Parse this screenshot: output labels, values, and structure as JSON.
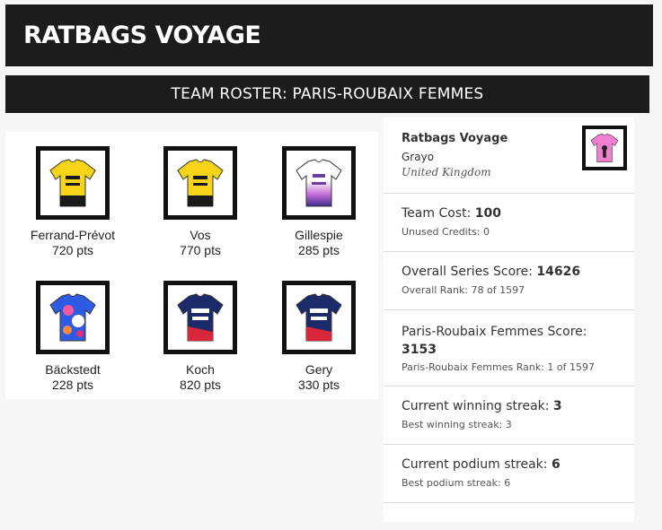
{
  "page": {
    "title": "RATBAGS VOYAGE",
    "subtitle": "TEAM ROSTER: PARIS-ROUBAIX FEMMES"
  },
  "riders": [
    {
      "name": "Ferrand-Prévot",
      "pts": "720 pts",
      "jersey": "visma-jersey-icon"
    },
    {
      "name": "Vos",
      "pts": "770 pts",
      "jersey": "visma-jersey-icon"
    },
    {
      "name": "Gillespie",
      "pts": "285 pts",
      "jersey": "uae-jersey-icon"
    },
    {
      "name": "Bäckstedt",
      "pts": "228 pts",
      "jersey": "canyon-jersey-icon"
    },
    {
      "name": "Koch",
      "pts": "820 pts",
      "jersey": "fdj-jersey-icon"
    },
    {
      "name": "Gery",
      "pts": "330 pts",
      "jersey": "fdj-jersey-icon"
    }
  ],
  "team": {
    "name": "Ratbags Voyage",
    "owner": "Grayo",
    "country": "United Kingdom",
    "jersey": "pink-team-jersey-icon"
  },
  "stats": {
    "cost_label": "Team Cost:",
    "cost_value": "100",
    "credits": "Unused Credits: 0",
    "series_label": "Overall Series Score:",
    "series_value": "14626",
    "series_rank": "Overall Rank: 78 of 1597",
    "race_label": "Paris-Roubaix Femmes Score:",
    "race_value": "3153",
    "race_rank": "Paris-Roubaix Femmes Rank: 1 of 1597",
    "win_label": "Current winning streak:",
    "win_value": "3",
    "win_best": "Best winning streak: 3",
    "podium_label": "Current podium streak:",
    "podium_value": "6",
    "podium_best": "Best podium streak: 6"
  },
  "colors": {
    "bar_bg": "#1c1c1c",
    "visma_yellow": "#f7d417",
    "uae_white": "#ffffff",
    "uae_purple": "#6a3fa0",
    "fdj_navy": "#1b2a6b",
    "fdj_red": "#d8263a",
    "canyon_blue": "#2d5be3",
    "team_pink": "#f07fd0"
  }
}
